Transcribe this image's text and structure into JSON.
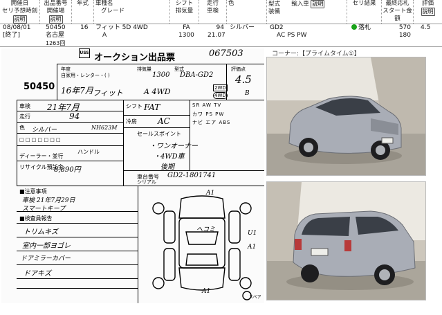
{
  "header": {
    "col_date": [
      "開催日",
      "セリ予想時刻"
    ],
    "col_lot": [
      "出品番号",
      "開催場"
    ],
    "col_year": "年式",
    "col_model": [
      "車種名",
      "グレード"
    ],
    "col_shift": [
      "シフト",
      "排気量"
    ],
    "col_mileage": [
      "走行",
      "車検"
    ],
    "col_color": "色",
    "col_type": [
      "型式",
      "装備"
    ],
    "col_import": "輸入車",
    "col_result": "セリ結果",
    "col_price": [
      "最終応札",
      "スタート金額"
    ],
    "col_grade": "評価",
    "explain_label": "説明"
  },
  "row": {
    "date": "08/08/01",
    "time_status": "[終了]",
    "lot": "50450",
    "venue": "名古屋",
    "venue_code": "1263回",
    "year": "16",
    "model": "フィット 5D 4WD",
    "grade": "A",
    "shift": "FA",
    "displacement": "1300",
    "mileage": "94",
    "inspection": "21.07",
    "color": "シルバー",
    "type_code": "GD2",
    "equipment": "AC PS PW",
    "result": "落札",
    "final_bid": "570",
    "start_price": "180",
    "score": "4.5"
  },
  "sheet": {
    "logo": "USS",
    "title": "オークション出品票",
    "lot_stamp": "067503",
    "lot": "50450",
    "corner_label": "コーナー:【プライムタイム①】",
    "labels": {
      "year_label": "年度",
      "car_kind": "自家用・レンター・( )",
      "displacement_label": "排気量",
      "model_label": "型式",
      "score_label": "評価点",
      "mileage": "走行",
      "inspection": "車検",
      "color": "色",
      "shift": "シフト",
      "aircon": "冷房",
      "selling_points": "セールスポイント",
      "handle": "ハンドル",
      "dealer": "ディーラー・並行",
      "recycle": "リサイクル預託金",
      "chassis": "車台番号",
      "serial": "シリアル",
      "notes": "注意事項",
      "inspector_report": "検査員報告",
      "equip_row1": [
        "SR",
        "AW",
        "TV"
      ],
      "equip_row2": [
        "カワ",
        "PS",
        "PW"
      ],
      "equip_row3": [
        "ナビ",
        "エア",
        "ABS"
      ],
      "spare": "スペア"
    },
    "hand": {
      "year": "16年7月",
      "model_name": "フィット",
      "grade": "A 4WD",
      "displacement": "1300",
      "type": "DBA-GD2",
      "score": "4.5",
      "interior": "B",
      "inspection": "21年7月",
      "mileage_val": "94",
      "color_val": "シルバー",
      "color_code": "NH623M",
      "shift_val": "FAT",
      "aircon_val": "AC",
      "point1": "・ワンオーナー",
      "point2": "・4WD車",
      "point3": "後期",
      "recycle_val": "8,890円",
      "chassis": "GD2-1801741",
      "note1": "車検 21年7月29日",
      "note2": "スマートキープ",
      "report1": "トリムキズ",
      "report2": "室内一部ヨゴレ",
      "report3": "ドアミラーカバー",
      "report4": "ドアキズ",
      "mark_a1_top": "A1",
      "mark_u1": "U1",
      "mark_a1_right": "A1",
      "mark_a1_bottom": "A1"
    }
  },
  "colors": {
    "accent_green": "#1aa31a",
    "car_silver": "#a9adb6"
  }
}
